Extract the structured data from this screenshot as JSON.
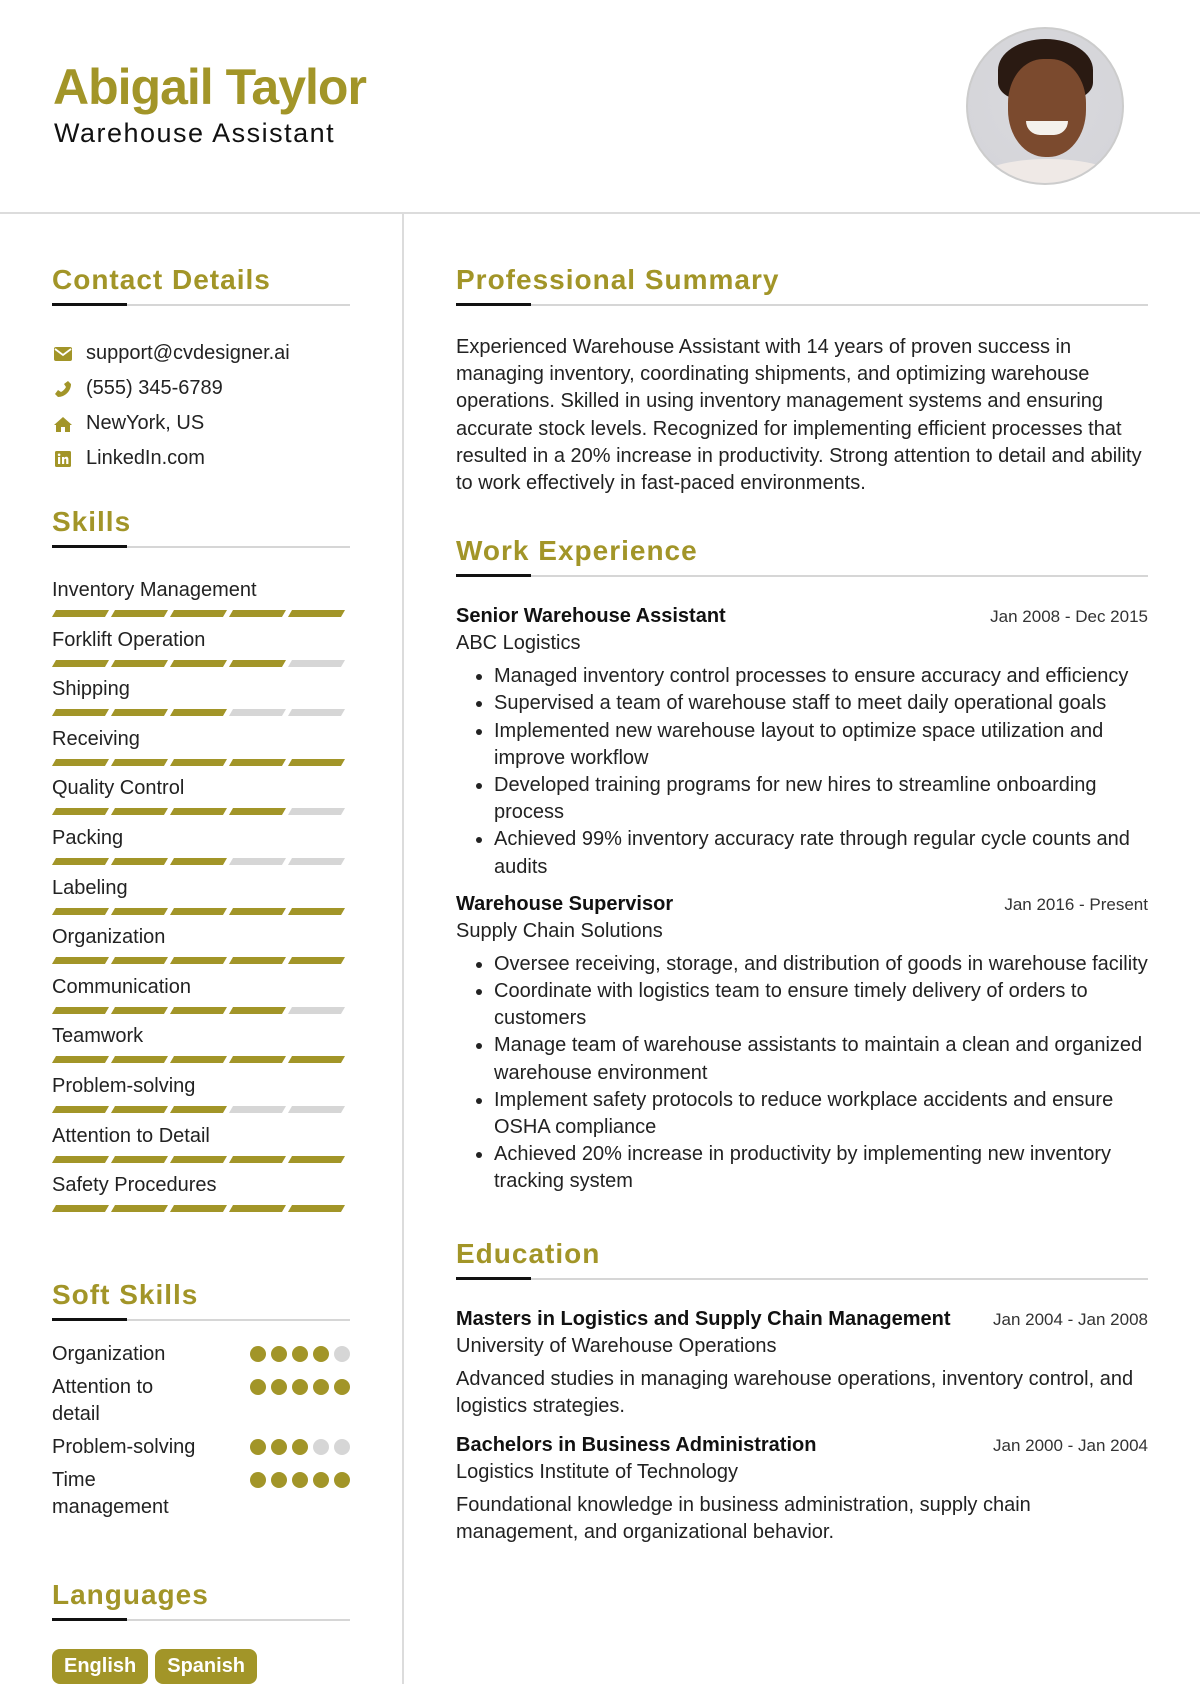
{
  "header": {
    "name": "Abigail Taylor",
    "role": "Warehouse Assistant",
    "photo_alt": "Profile photo"
  },
  "theme": {
    "accent": "#a29528",
    "rule": "#d6d6d6",
    "text": "#222222"
  },
  "contact": {
    "title": "Contact Details",
    "items": [
      {
        "icon": "envelope-icon",
        "text": "support@cvdesigner.ai"
      },
      {
        "icon": "phone-icon",
        "text": "(555) 345-6789"
      },
      {
        "icon": "home-icon",
        "text": "NewYork, US"
      },
      {
        "icon": "linkedin-icon",
        "text": "LinkedIn.com"
      }
    ]
  },
  "skills": {
    "title": "Skills",
    "max": 5,
    "items": [
      {
        "name": "Inventory Management",
        "level": 5
      },
      {
        "name": "Forklift Operation",
        "level": 4
      },
      {
        "name": "Shipping",
        "level": 3
      },
      {
        "name": "Receiving",
        "level": 5
      },
      {
        "name": "Quality Control",
        "level": 4
      },
      {
        "name": "Packing",
        "level": 3
      },
      {
        "name": "Labeling",
        "level": 5
      },
      {
        "name": "Organization",
        "level": 5
      },
      {
        "name": "Communication",
        "level": 4
      },
      {
        "name": "Teamwork",
        "level": 5
      },
      {
        "name": "Problem-solving",
        "level": 3
      },
      {
        "name": "Attention to Detail",
        "level": 5
      },
      {
        "name": "Safety Procedures",
        "level": 5
      }
    ]
  },
  "soft_skills": {
    "title": "Soft Skills",
    "max": 5,
    "items": [
      {
        "name": "Organization",
        "level": 4
      },
      {
        "name": "Attention to detail",
        "level": 5
      },
      {
        "name": "Problem-solving",
        "level": 3
      },
      {
        "name": "Time management",
        "level": 5
      }
    ]
  },
  "languages": {
    "title": "Languages",
    "items": [
      "English",
      "Spanish"
    ]
  },
  "summary": {
    "title": "Professional Summary",
    "text": "Experienced Warehouse Assistant with 14 years of proven success in managing inventory, coordinating shipments, and optimizing warehouse operations. Skilled in using inventory management systems and ensuring accurate stock levels. Recognized for implementing efficient processes that resulted in a 20% increase in productivity. Strong attention to detail and ability to work effectively in fast-paced environments."
  },
  "experience": {
    "title": "Work Experience",
    "jobs": [
      {
        "title": "Senior Warehouse Assistant",
        "company": "ABC Logistics",
        "dates": "Jan 2008 - Dec 2015",
        "bullets": [
          "Managed inventory control processes to ensure accuracy and efficiency",
          "Supervised a team of warehouse staff to meet daily operational goals",
          "Implemented new warehouse layout to optimize space utilization and improve workflow",
          "Developed training programs for new hires to streamline onboarding process",
          "Achieved 99% inventory accuracy rate through regular cycle counts and audits"
        ]
      },
      {
        "title": "Warehouse Supervisor",
        "company": "Supply Chain Solutions",
        "dates": "Jan 2016 - Present",
        "bullets": [
          "Oversee receiving, storage, and distribution of goods in warehouse facility",
          "Coordinate with logistics team to ensure timely delivery of orders to customers",
          "Manage team of warehouse assistants to maintain a clean and organized warehouse environment",
          "Implement safety protocols to reduce workplace accidents and ensure OSHA compliance",
          "Achieved 20% increase in productivity by implementing new inventory tracking system"
        ]
      }
    ]
  },
  "education": {
    "title": "Education",
    "items": [
      {
        "degree": "Masters in Logistics and Supply Chain Management",
        "school": "University of Warehouse Operations",
        "dates": "Jan 2004 - Jan 2008",
        "description": "Advanced studies in managing warehouse operations, inventory control, and logistics strategies."
      },
      {
        "degree": "Bachelors in Business Administration",
        "school": "Logistics Institute of Technology",
        "dates": "Jan 2000 - Jan 2004",
        "description": "Foundational knowledge in business administration, supply chain management, and organizational behavior."
      }
    ]
  }
}
